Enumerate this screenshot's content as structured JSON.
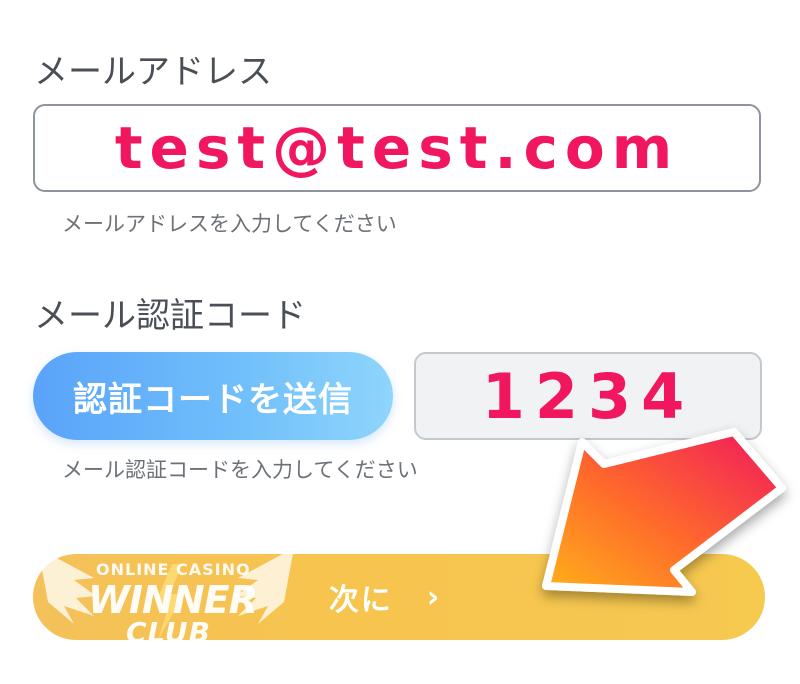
{
  "email": {
    "label": "メールアドレス",
    "value": "test@test.com",
    "hint": "メールアドレスを入力してください"
  },
  "verification": {
    "label": "メール認証コード",
    "send_button_label": "認証コードを送信",
    "code_value": "1234",
    "hint": "メール認証コードを入力してください"
  },
  "next_button": {
    "label": "次に",
    "chevron": "›"
  },
  "watermark": {
    "line1": "ONLINE CASINO",
    "line2": "WINNER",
    "line3": "CLUB"
  },
  "colors": {
    "highlight_text": "#f0175f",
    "send_button": "#6bb6fb",
    "next_button": "#f6c450",
    "arrow_top": "#f0175f",
    "arrow_bottom": "#ffb11a"
  },
  "icons": {
    "pointer": "arrow-pointer-icon",
    "next": "chevron-right-icon"
  }
}
